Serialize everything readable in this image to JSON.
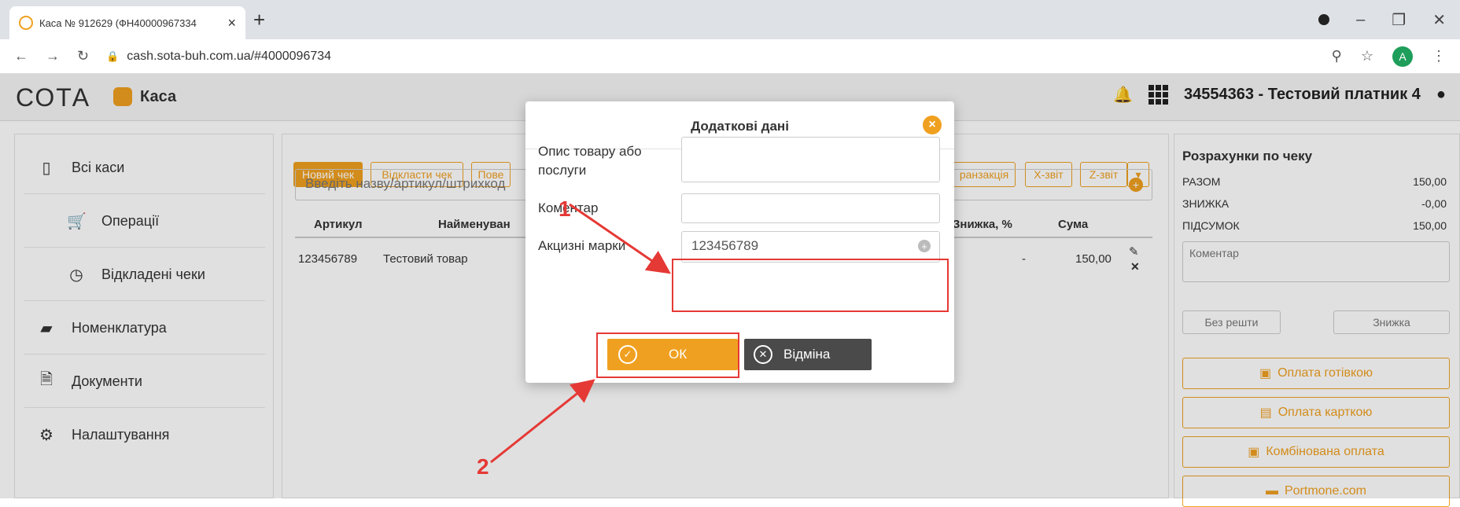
{
  "browser": {
    "tab_title": "Каса № 912629 (ФН40000967334",
    "tab_close": "×",
    "new_tab": "+",
    "url": "cash.sota-buh.com.ua/#4000096734"
  },
  "app": {
    "logo": "СОТА",
    "section": "Каса",
    "company": "34554363 - Тестовий платник 4"
  },
  "sidebar": {
    "items": [
      {
        "label": "Всі каси",
        "icon": "tablet-icon"
      },
      {
        "label": "Операції",
        "icon": "cart-icon"
      },
      {
        "label": "Відкладені чеки",
        "icon": "clock-icon"
      },
      {
        "label": "Номенклатура",
        "icon": "book-icon"
      },
      {
        "label": "Документи",
        "icon": "document-icon"
      },
      {
        "label": "Налаштування",
        "icon": "gears-icon"
      }
    ]
  },
  "toolbar": {
    "new_check": "Новий чек",
    "defer_check": "Відкласти чек",
    "return": "Пове",
    "transaction": "ранзакція",
    "x_report": "X-звіт",
    "z_report": "Z-звіт"
  },
  "search": {
    "placeholder": "Введіть назву/артикул/штрихкод"
  },
  "table": {
    "headers": [
      "Артикул",
      "Найменуван",
      "Знижка, %",
      "Сума"
    ],
    "rows": [
      {
        "article": "123456789",
        "name": "Тестовий товар",
        "discount": "-",
        "sum": "150,00"
      }
    ]
  },
  "summary": {
    "title": "Розрахунки по чеку",
    "rows": [
      {
        "label": "РАЗОМ",
        "value": "150,00"
      },
      {
        "label": "ЗНИЖКА",
        "value": "-0,00"
      },
      {
        "label": "ПІДСУМОК",
        "value": "150,00"
      }
    ],
    "comment_placeholder": "Коментар",
    "no_change": "Без решти",
    "discount": "Знижка",
    "pay_cash": "Оплата готівкою",
    "pay_card": "Оплата карткою",
    "pay_combined": "Комбінована оплата",
    "pay_portmone": "Portmone.com"
  },
  "modal": {
    "title": "Додаткові дані",
    "desc_label": "Опис товару або послуги",
    "comment_label": "Коментар",
    "excise_label": "Акцизні марки",
    "excise_value": "123456789",
    "ok": "ОК",
    "cancel": "Відміна"
  },
  "annotations": {
    "n1": "1",
    "n2": "2"
  }
}
